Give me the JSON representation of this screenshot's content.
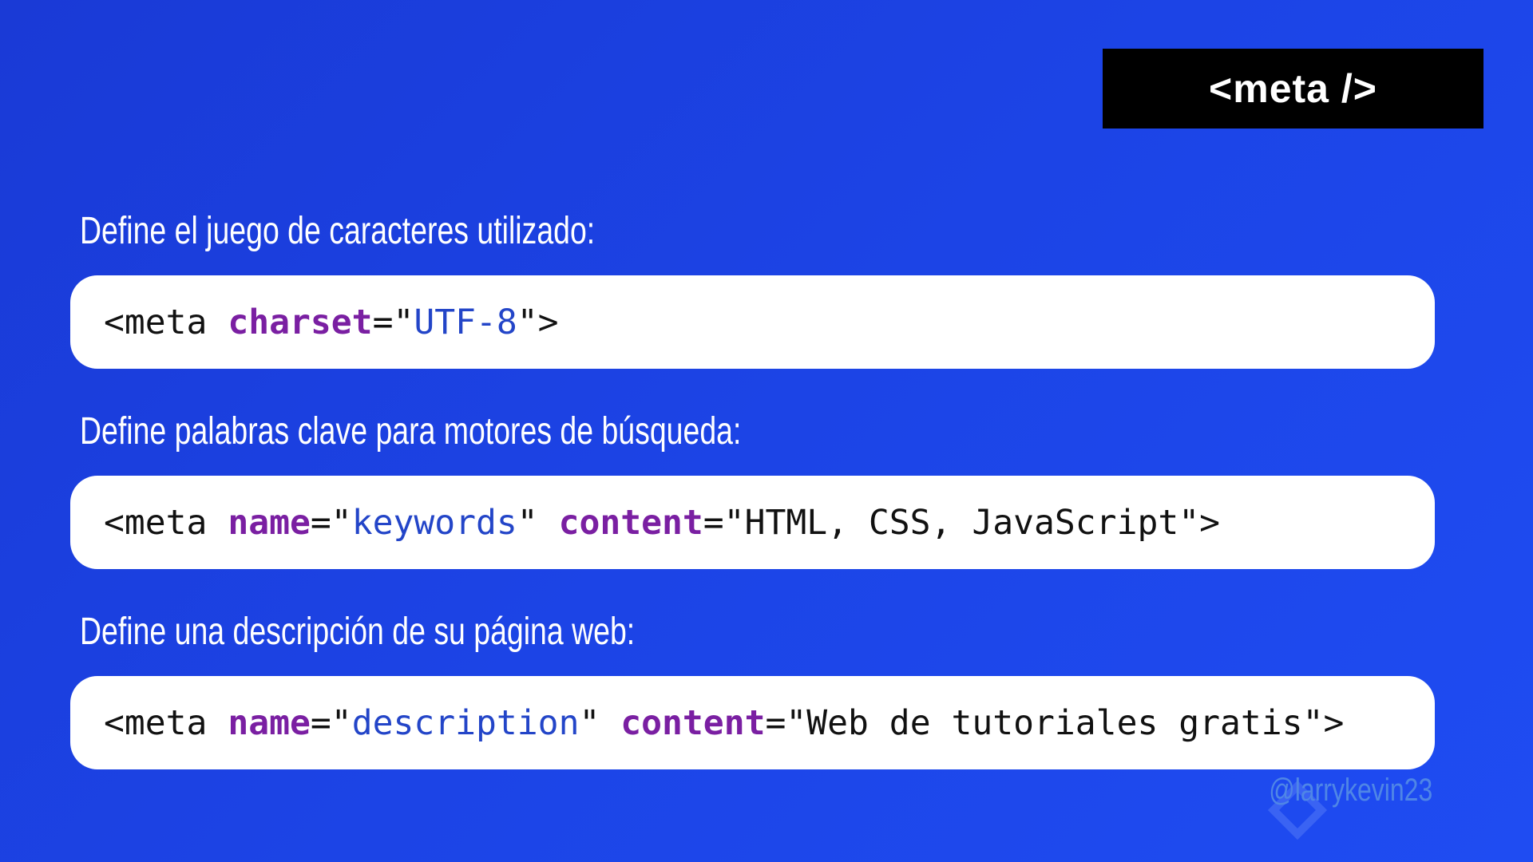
{
  "slide": {
    "title_tag": "<meta />",
    "watermark": "@larrykevin23",
    "colors": {
      "background": "#1c44e6",
      "title_box": "#000000",
      "code_box": "#ffffff",
      "attribute": "#7a1fa2",
      "value": "#2345c8",
      "text": "#111111"
    }
  },
  "sections": [
    {
      "caption": "Define el juego de caracteres utilizado:",
      "code": {
        "open": "<meta ",
        "attr1": "charset",
        "eq1": "=\"",
        "val1": "UTF-8",
        "close": "\">"
      }
    },
    {
      "caption": "Define palabras clave para motores de búsqueda:",
      "code": {
        "open": "<meta ",
        "attr1": "name",
        "eq1": "=\"",
        "val1": "keywords",
        "mid": "\" ",
        "attr2": "content",
        "eq2": "=\"",
        "val2": "HTML, CSS, JavaScript",
        "close": "\">"
      }
    },
    {
      "caption": "Define una descripción de su página web:",
      "code": {
        "open": "<meta ",
        "attr1": "name",
        "eq1": "=\"",
        "val1": "description",
        "mid": "\" ",
        "attr2": "content",
        "eq2": "=\"",
        "val2": "Web de tutoriales gratis",
        "close": "\">"
      }
    }
  ]
}
